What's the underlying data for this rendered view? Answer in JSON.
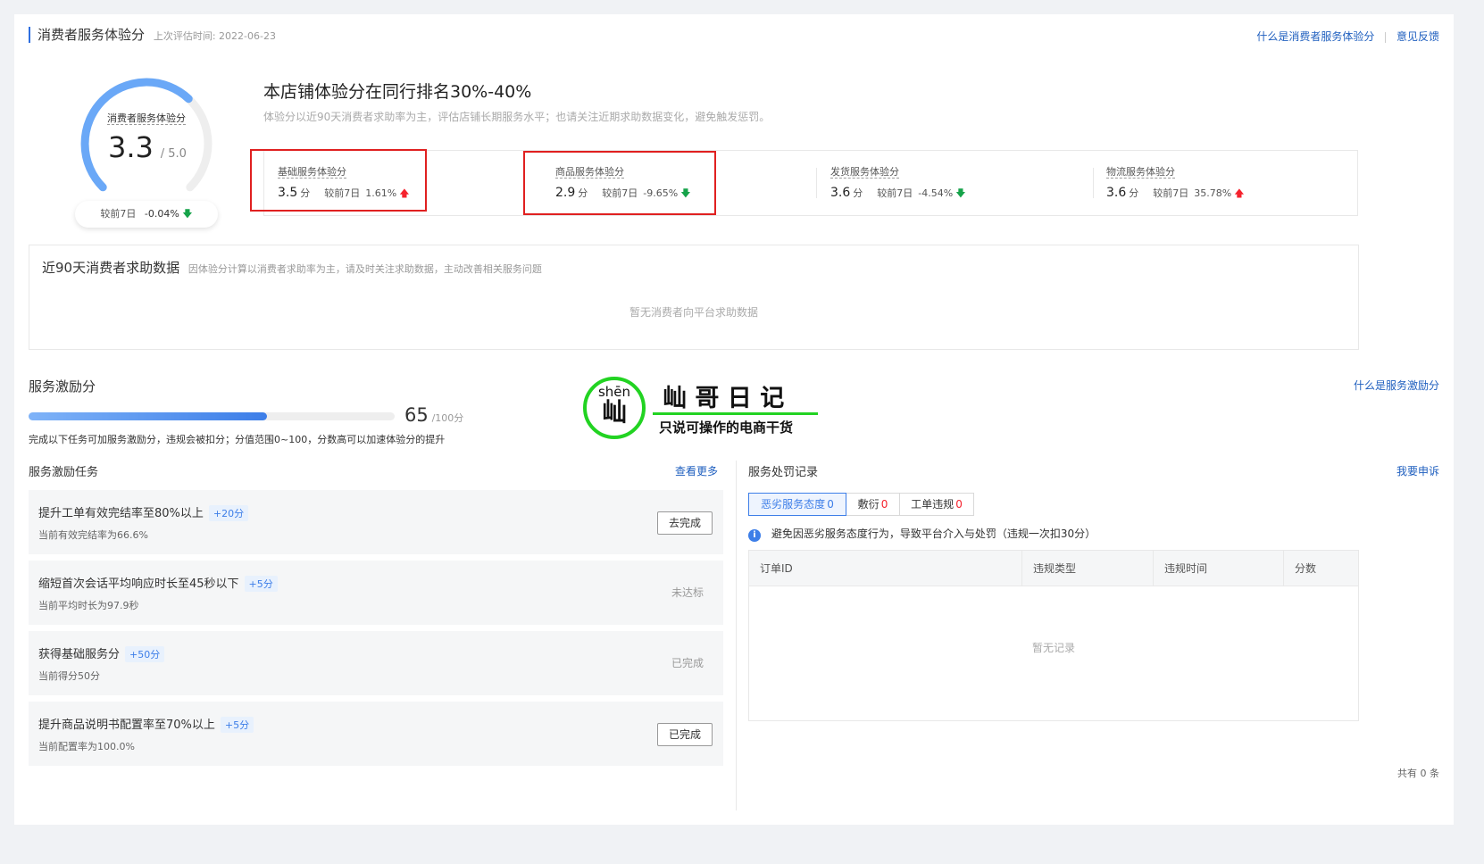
{
  "header": {
    "title": "消费者服务体验分",
    "last_eval_label": "上次评估时间: 2022-06-23",
    "link_what": "什么是消费者服务体验分",
    "link_feedback": "意见反馈"
  },
  "gauge": {
    "label": "消费者服务体验分",
    "score": "3.3",
    "max": "/ 5.0",
    "score_fraction": 0.66,
    "compare_label": "较前7日",
    "compare_value": "-0.04%",
    "colors": {
      "fill": "#6aa8f7",
      "track": "#eeeeee"
    }
  },
  "summary": {
    "headline": "本店铺体验分在同行排名30%-40%",
    "desc": "体验分以近90天消费者求助率为主，评估店铺长期服务水平；也请关注近期求助数据变化，避免触发惩罚。"
  },
  "stats": [
    {
      "label": "基础服务体验分",
      "score": "3.5",
      "unit": "分",
      "compare": "较前7日",
      "change": "1.61%",
      "dir": "up"
    },
    {
      "label": "商品服务体验分",
      "score": "2.9",
      "unit": "分",
      "compare": "较前7日",
      "change": "-9.65%",
      "dir": "down"
    },
    {
      "label": "发货服务体验分",
      "score": "3.6",
      "unit": "分",
      "compare": "较前7日",
      "change": "-4.54%",
      "dir": "down"
    },
    {
      "label": "物流服务体验分",
      "score": "3.6",
      "unit": "分",
      "compare": "较前7日",
      "change": "35.78%",
      "dir": "up"
    }
  ],
  "help_data": {
    "title": "近90天消费者求助数据",
    "subtitle": "因体验分计算以消费者求助率为主，请及时关注求助数据，主动改善相关服务问题",
    "empty": "暂无消费者向平台求助数据"
  },
  "incentive": {
    "title": "服务激励分",
    "link": "什么是服务激励分",
    "score": "65",
    "max": "/100分",
    "fraction": 0.65,
    "desc": "完成以下任务可加服务激励分，违规会被扣分；分值范围0~100，分数高可以加速体验分的提升"
  },
  "watermark": {
    "pinyin": "shēn",
    "char": "屾",
    "title": "屾 哥 日 记",
    "subtitle": "只说可操作的电商干货"
  },
  "tasks": {
    "title": "服务激励任务",
    "more": "查看更多",
    "items": [
      {
        "title": "提升工单有效完结率至80%以上",
        "tag": "+20分",
        "sub": "当前有效完结率为66.6%",
        "action": "去完成",
        "action_type": "button"
      },
      {
        "title": "缩短首次会话平均响应时长至45秒以下",
        "tag": "+5分",
        "sub": "当前平均时长为97.9秒",
        "action": "未达标",
        "action_type": "text"
      },
      {
        "title": "获得基础服务分",
        "tag": "+50分",
        "sub": "当前得分50分",
        "action": "已完成",
        "action_type": "text"
      },
      {
        "title": "提升商品说明书配置率至70%以上",
        "tag": "+5分",
        "sub": "当前配置率为100.0%",
        "action": "已完成",
        "action_type": "button"
      }
    ]
  },
  "penalty": {
    "title": "服务处罚记录",
    "appeal": "我要申诉",
    "tabs": [
      {
        "label": "恶劣服务态度",
        "count": "0",
        "active": true
      },
      {
        "label": "敷衍",
        "count": "0",
        "active": false
      },
      {
        "label": "工单违规",
        "count": "0",
        "active": false
      }
    ],
    "notice": "避免因恶劣服务态度行为，导致平台介入与处罚（违规一次扣30分）",
    "columns": [
      "订单ID",
      "违规类型",
      "违规时间",
      "分数"
    ],
    "empty": "暂无记录",
    "total": "共有 0 条"
  }
}
